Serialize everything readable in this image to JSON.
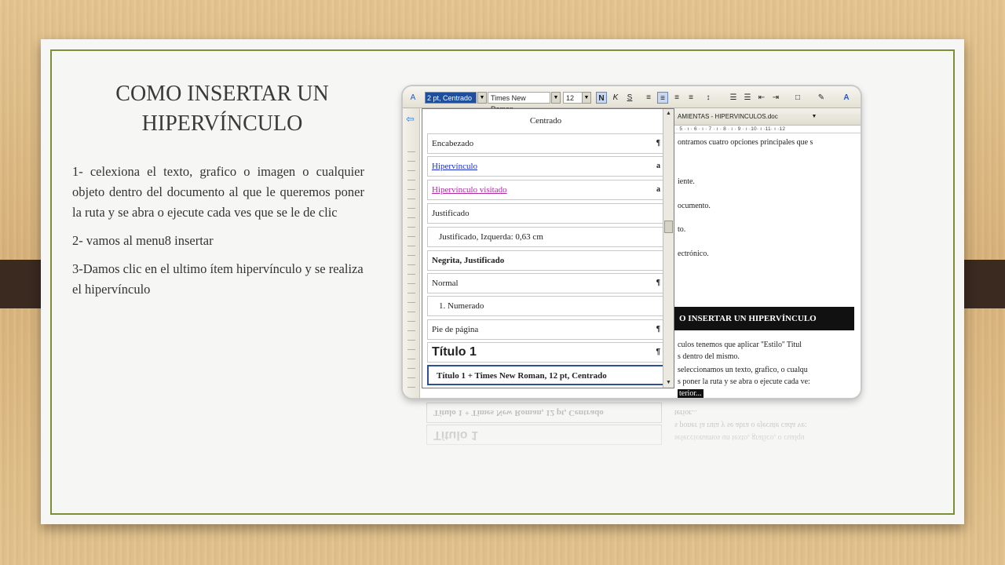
{
  "slide": {
    "title": "COMO INSERTAR UN HIPERVÍNCULO",
    "paragraphs": [
      "1- celexiona el texto, grafico o imagen o cualquier objeto dentro del documento al que le queremos poner la ruta y se abra o ejecute cada ves que se le de clic",
      "2- vamos al menu8 insertar",
      "3-Damos clic en el ultimo ítem hipervínculo y se realiza el hipervínculo"
    ]
  },
  "screenshot": {
    "toolbar": {
      "style_value": "2 pt, Centrado",
      "font_value": "Times New Roman",
      "size_value": "12",
      "bold": "N",
      "italic": "K",
      "underline": "S"
    },
    "style_list": [
      {
        "label": "Centrado",
        "mark": ""
      },
      {
        "label": "Encabezado",
        "mark": "¶"
      },
      {
        "label": "Hipervínculo",
        "mark": "a"
      },
      {
        "label": "Hipervínculo visitado",
        "mark": "a"
      },
      {
        "label": "Justificado",
        "mark": ""
      },
      {
        "label": "Justificado, Izquerda:  0,63 cm",
        "mark": ""
      },
      {
        "label": "Negrita, Justificado",
        "mark": ""
      },
      {
        "label": "Normal",
        "mark": "¶"
      },
      {
        "label": "1.  Numerado",
        "mark": ""
      },
      {
        "label": "Pie de página",
        "mark": "¶"
      },
      {
        "label": "Título 1",
        "mark": "¶"
      },
      {
        "label": "Título 1 + Times New Roman, 12 pt, Centrado",
        "mark": ""
      }
    ],
    "document": {
      "title": "AMIENTAS - HIPERVINCULOS.doc",
      "ruler": "· 5 · ı · 6 · ı · 7 · ı · 8 · ı · 9 · ı ·10· ı ·11· ı ·12",
      "lines": [
        "ontramos cuatro opciones principales que s",
        "iente.",
        "ocumento.",
        "to.",
        "ectrónico."
      ],
      "banner": "O INSERTAR UN HIPERVÍNCULO",
      "lines_after": [
        "culos tenemos que aplicar ''Estilo'' Titul",
        "s dentro del mismo.",
        "seleccionamos un texto, grafico, o cualqu",
        "s poner la ruta y se abra o ejecute cada ve:"
      ],
      "highlight": "terior..."
    }
  }
}
